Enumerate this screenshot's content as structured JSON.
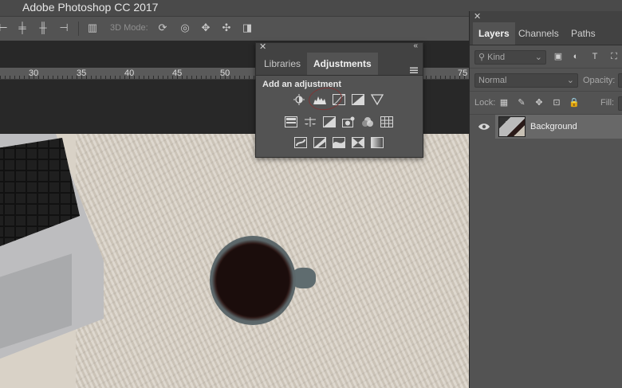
{
  "app": {
    "title": "Adobe Photoshop CC 2017"
  },
  "options_bar": {
    "mode_label": "3D Mode:"
  },
  "ruler": {
    "ticks": [
      "30",
      "35",
      "40",
      "45",
      "50",
      "75"
    ]
  },
  "adjustments_panel": {
    "tabs": [
      "Libraries",
      "Adjustments"
    ],
    "active_tab": "Adjustments",
    "heading": "Add an adjustment",
    "icons_row1": [
      "brightness-contrast-icon",
      "levels-icon",
      "curves-icon",
      "exposure-icon"
    ],
    "icons_row1b": [
      "vibrance-icon"
    ],
    "icons_row2": [
      "hue-saturation-icon",
      "color-balance-icon",
      "black-white-icon",
      "photo-filter-icon",
      "channel-mixer-icon",
      "color-lookup-icon"
    ],
    "icons_row3": [
      "invert-icon",
      "posterize-icon",
      "threshold-icon",
      "selective-color-icon",
      "gradient-map-icon"
    ],
    "highlight_color": "#7d3636"
  },
  "layers_panel": {
    "tabs": [
      "Layers",
      "Channels",
      "Paths"
    ],
    "active_tab": "Layers",
    "filter_label": "Kind",
    "blend_mode": "Normal",
    "opacity_label": "Opacity:",
    "lock_label": "Lock:",
    "fill_label": "Fill:",
    "layers": [
      {
        "name": "Background",
        "visible": true
      }
    ]
  },
  "colors": {
    "accent": "#7d3636",
    "panel": "#535353",
    "panel_dark": "#424242"
  }
}
